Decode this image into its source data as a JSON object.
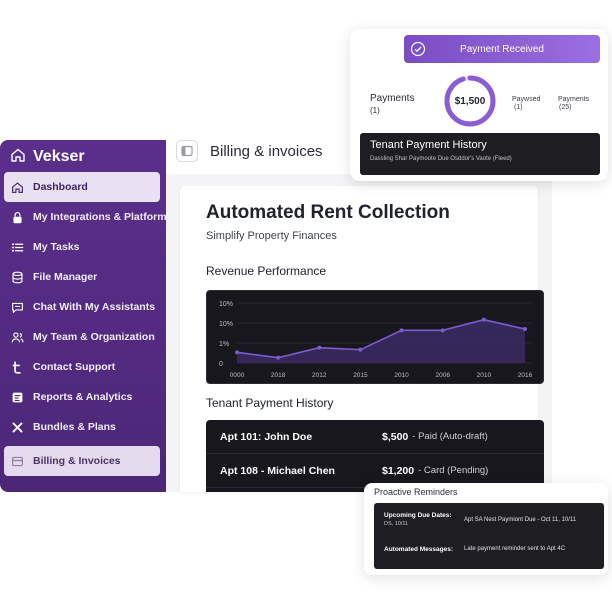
{
  "sidebar": {
    "brand": "Vekser",
    "items": [
      {
        "label": "Dashboard",
        "icon": "home-icon"
      },
      {
        "label": "My Integrations & Platforms",
        "icon": "lock-icon"
      },
      {
        "label": "My Tasks",
        "icon": "list-icon"
      },
      {
        "label": "File Manager",
        "icon": "database-icon"
      },
      {
        "label": "Chat With My Assistants",
        "icon": "chat-icon"
      },
      {
        "label": "My Team & Organization",
        "icon": "team-icon"
      },
      {
        "label": "Contact Support",
        "icon": "support-icon"
      },
      {
        "label": "Reports & Analytics",
        "icon": "reports-icon"
      },
      {
        "label": "Bundles & Plans",
        "icon": "tools-icon"
      },
      {
        "label": "Billing & Invoices",
        "icon": "billing-icon"
      }
    ]
  },
  "header": {
    "title": "Billing & invoices"
  },
  "main": {
    "title": "Automated Rent Collection",
    "subtitle": "Simplify Property Finances",
    "revenue_title": "Revenue Performance",
    "history_title": "Tenant Payment History",
    "payments": [
      {
        "unit": "Apt 101: John Doe",
        "amount": "$,500",
        "status": "- Paid (Auto-draft)"
      },
      {
        "unit": "Apt 108 - Michael Chen",
        "amount": "$1,200",
        "status": "- Card (Pending)"
      }
    ]
  },
  "chart_data": {
    "type": "area",
    "categories": [
      "0000",
      "2018",
      "2012",
      "2015",
      "2010",
      "2006",
      "2010",
      "2016"
    ],
    "values": [
      1.6,
      0.8,
      2.3,
      2.0,
      4.9,
      4.9,
      6.5,
      5.1
    ],
    "y_ticks": [
      "10%",
      "10%",
      "1%",
      "0"
    ],
    "ylim": [
      0,
      9
    ],
    "grid": true,
    "colors": {
      "line": "#7c5ad0",
      "fill": "#3b2a63",
      "background": "#17171d"
    }
  },
  "payment_card": {
    "banner": "Payment Received",
    "payments_label": "Payments",
    "payments_count": "(1)",
    "total": "$1,500",
    "stat_a_label": "Paywsed",
    "stat_a_count": "(1)",
    "stat_b_label": "Payments",
    "stat_b_count": "(25)",
    "progress": 0.95,
    "history_title": "Tenant Payment History",
    "history_sub": "Dassling Shar Paymoote Due Osddor's Vaote (Fleed)",
    "accent": "#8a5cd6"
  },
  "reminders": {
    "title": "Proactive Reminders",
    "due_label": "Upcoming Due Dates:",
    "due_sub": "DS, 10/11",
    "due_text": "Apt SA Nest Paymiont Due - Oct 11, 10/11",
    "auto_label": "Automated Messages:",
    "auto_text": "Late payment reminder sent to Apt 4C"
  }
}
